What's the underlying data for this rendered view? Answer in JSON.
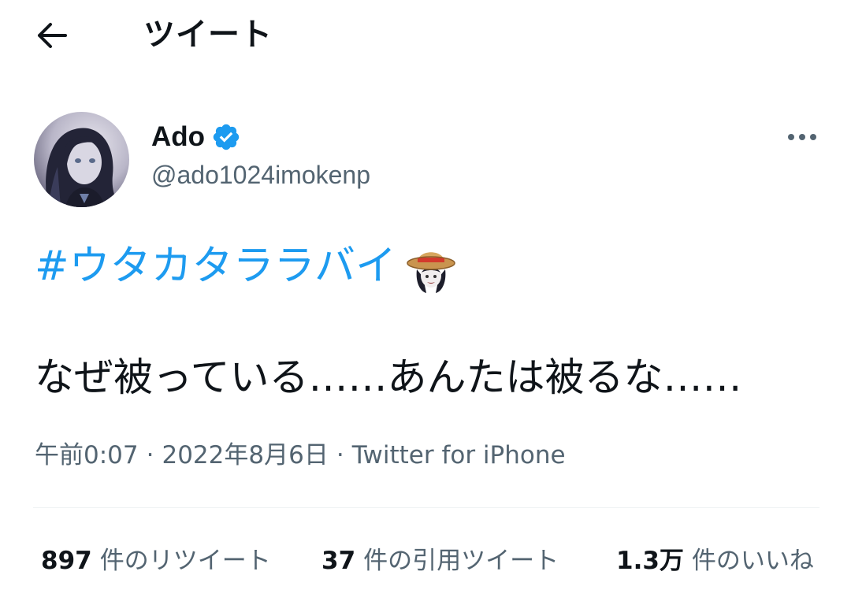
{
  "header": {
    "back_icon": "arrow-left-icon",
    "title": "ツイート"
  },
  "author": {
    "display_name": "Ado",
    "verified_icon": "verified-badge-icon",
    "handle": "@ado1024imokenp",
    "more_icon": "more-horizontal-icon"
  },
  "tweet": {
    "hashtag": "#ウタカタララバイ",
    "emoji": "straw-hat-character-emoji",
    "body": "なぜ被っている……あんたは被るな……",
    "time": "午前0:07",
    "separator": "·",
    "date": "2022年8月6日",
    "source": "Twitter for iPhone"
  },
  "stats": {
    "retweets": {
      "count": "897",
      "label": "件のリツイート"
    },
    "quotes": {
      "count": "37",
      "label": "件の引用ツイート"
    },
    "likes": {
      "count": "1.3万",
      "label": "件のいいね"
    }
  },
  "colors": {
    "link": "#1d9bf0",
    "secondary": "#536471",
    "primary": "#0f1419",
    "divider": "#eff3f4"
  }
}
